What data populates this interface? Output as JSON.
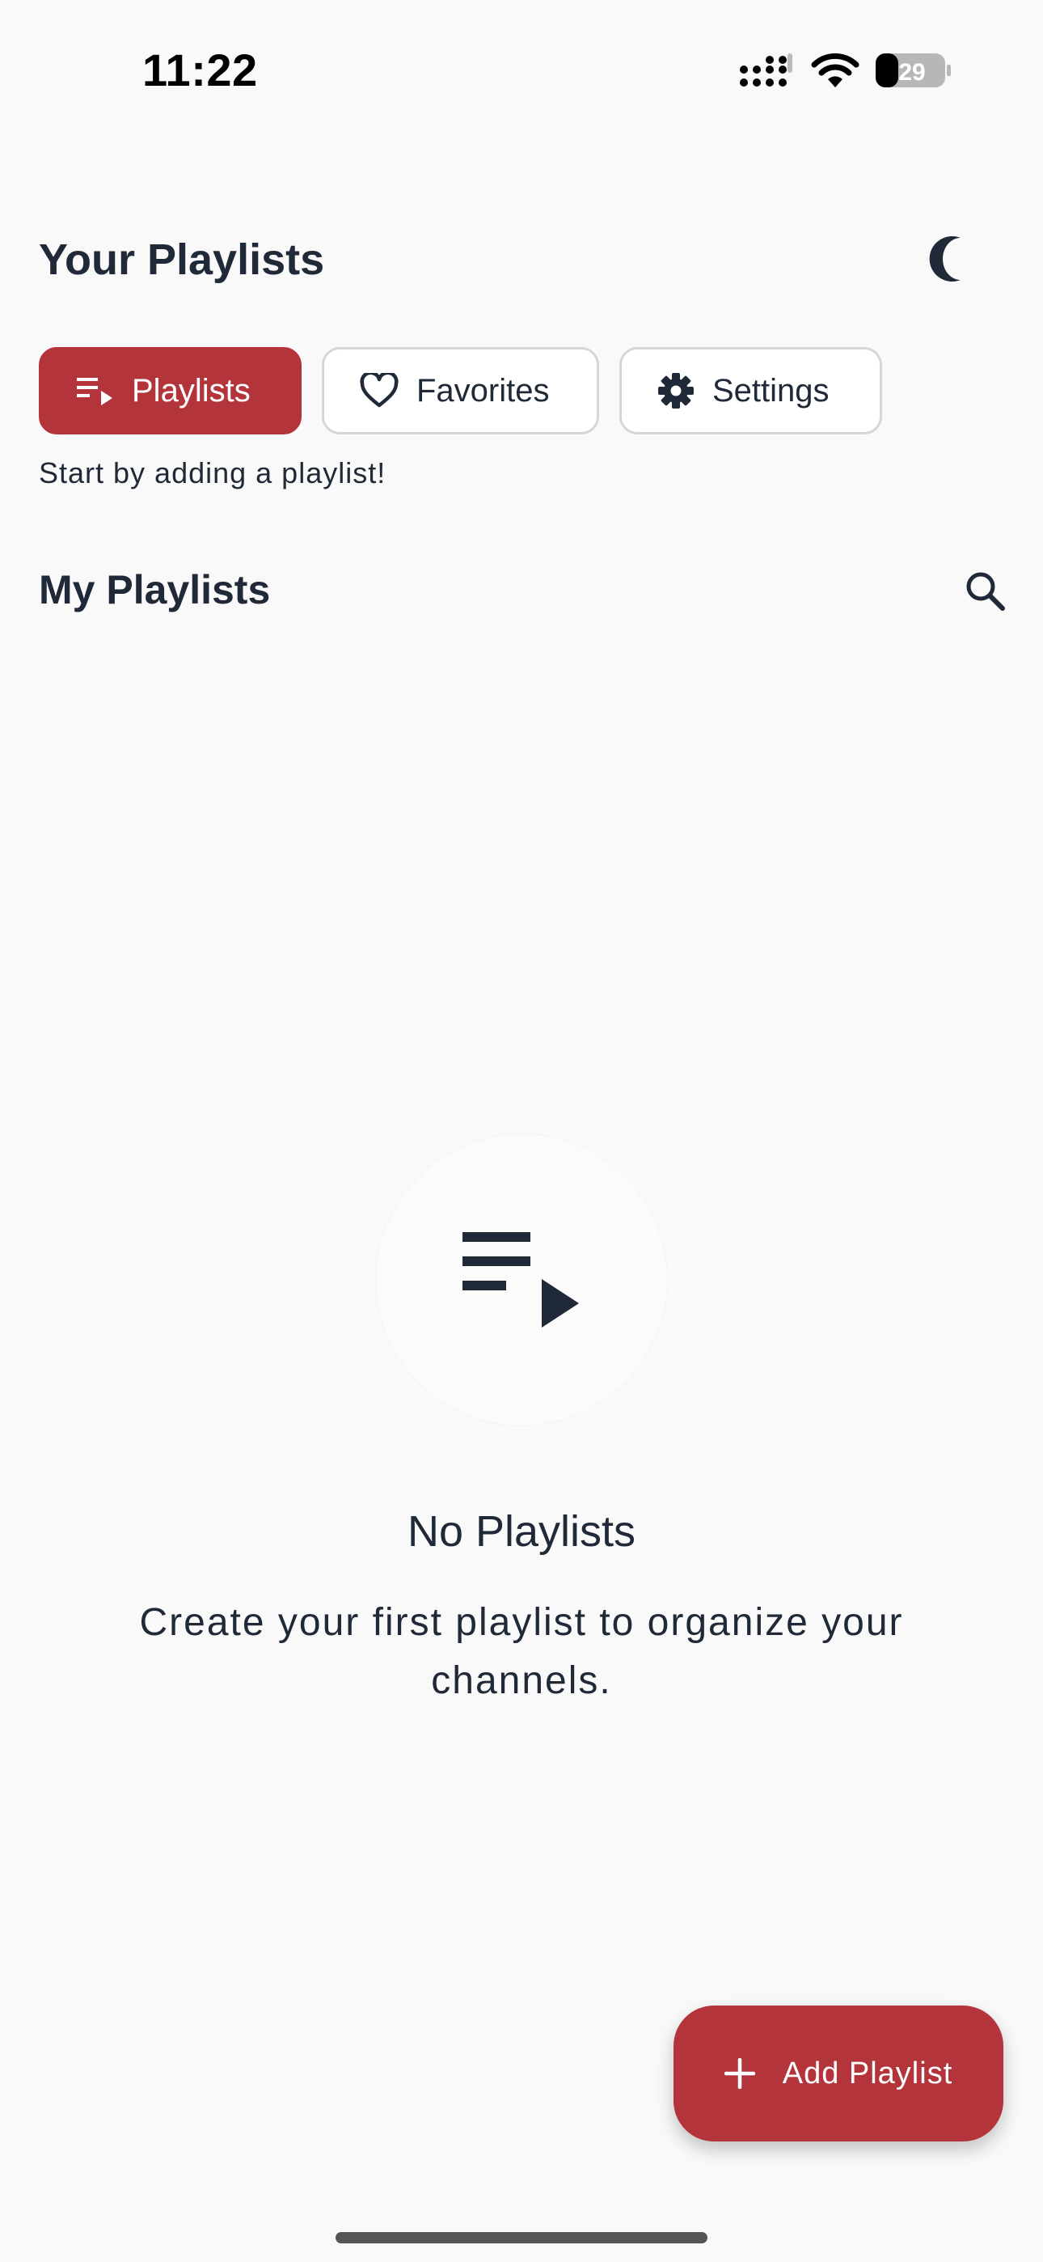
{
  "status_bar": {
    "time": "11:22",
    "battery_level": "29",
    "icons": [
      "signal-icon",
      "wifi-icon",
      "battery-icon"
    ]
  },
  "header": {
    "title": "Your Playlists",
    "theme_icon": "moon-icon"
  },
  "tabs": [
    {
      "label": "Playlists",
      "icon": "playlist-play-icon",
      "active": true
    },
    {
      "label": "Favorites",
      "icon": "heart-icon",
      "active": false
    },
    {
      "label": "Settings",
      "icon": "gear-icon",
      "active": false
    }
  ],
  "hint": "Start by adding a playlist!",
  "section": {
    "title": "My Playlists",
    "search_icon": "search-icon"
  },
  "empty_state": {
    "icon": "playlist-play-icon",
    "title": "No Playlists",
    "description": "Create your first playlist to organize your channels."
  },
  "fab": {
    "label": "Add Playlist",
    "icon": "plus-icon"
  },
  "colors": {
    "accent": "#b4343b",
    "background": "#f9f9f9",
    "text": "#1f2937"
  }
}
